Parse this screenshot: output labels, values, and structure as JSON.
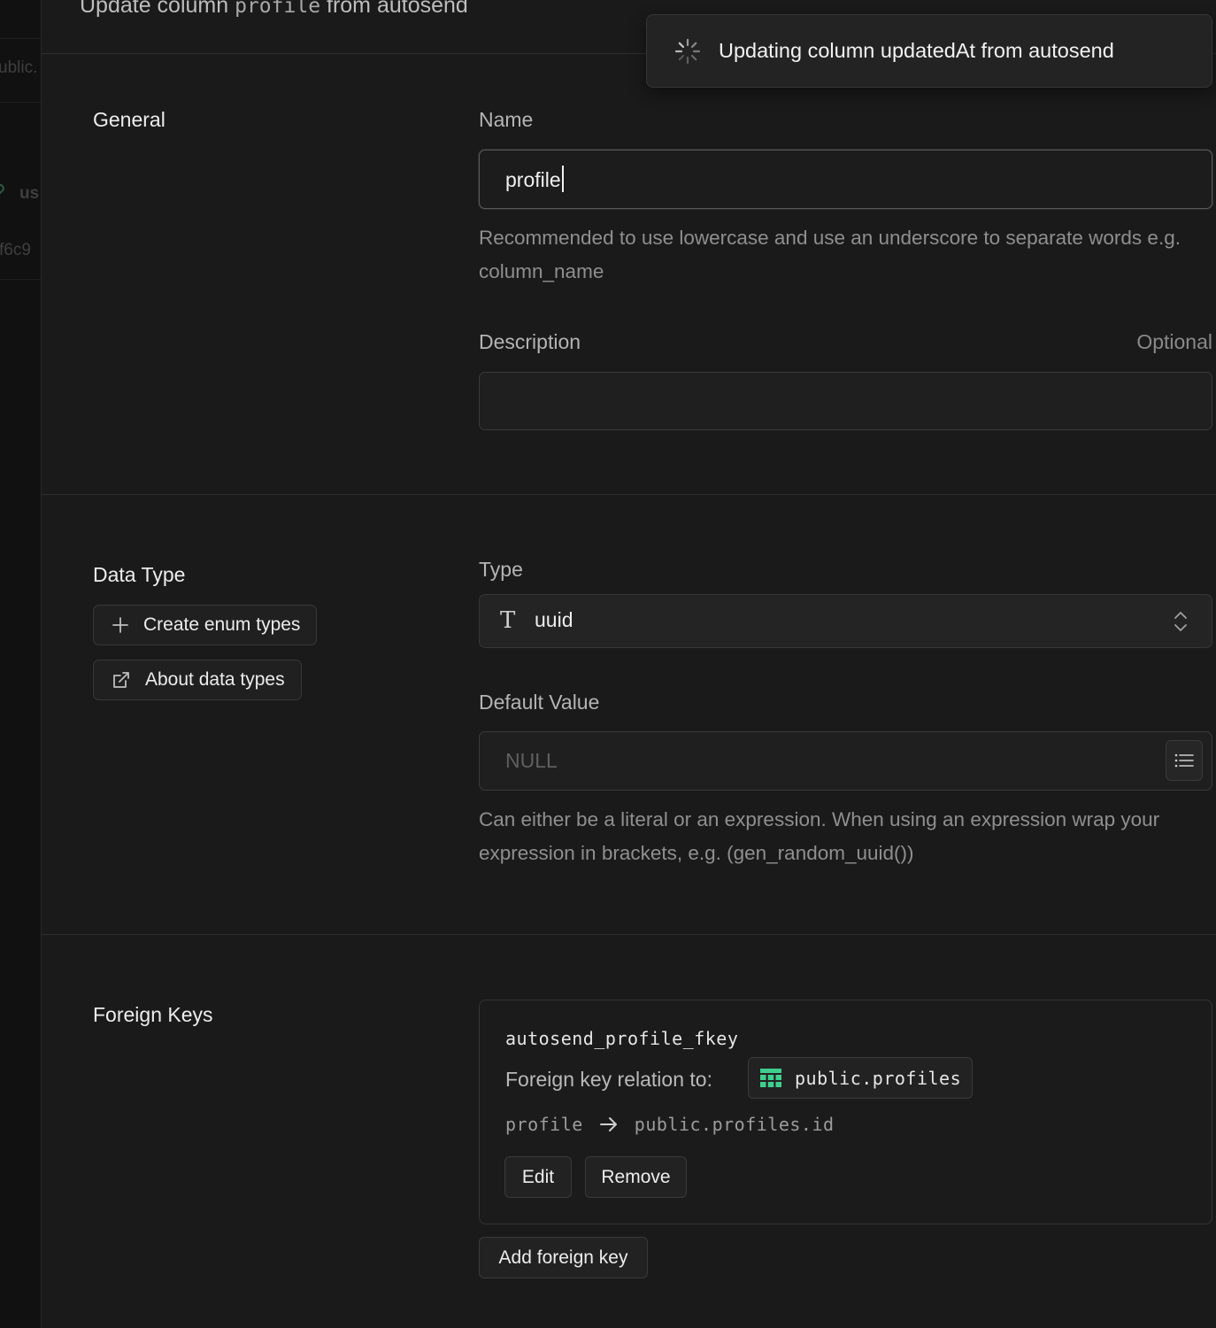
{
  "background_fragments": {
    "frag1": "ublic.",
    "frag2": "us",
    "frag3": "f6c9"
  },
  "header": {
    "title_prefix": "Update column",
    "column_name": "profile",
    "title_suffix": "from autosend"
  },
  "toast": {
    "icon": "spinner-icon",
    "message": "Updating column updatedAt from autosend"
  },
  "general": {
    "heading": "General",
    "name_label": "Name",
    "name_value": "profile",
    "name_help": "Recommended to use lowercase and use an underscore to separate words e.g. column_name",
    "description_label": "Description",
    "description_optional": "Optional",
    "description_value": ""
  },
  "data_type": {
    "heading": "Data Type",
    "create_enum_label": "Create enum types",
    "about_types_label": "About data types",
    "type_label": "Type",
    "type_icon_glyph": "T",
    "type_value": "uuid",
    "default_label": "Default Value",
    "default_placeholder": "NULL",
    "default_help": "Can either be a literal or an expression. When using an expression wrap your expression in brackets, e.g. (gen_random_uuid())"
  },
  "foreign_keys": {
    "heading": "Foreign Keys",
    "items": [
      {
        "name": "autosend_profile_fkey",
        "relation_label": "Foreign key relation to:",
        "relation_table": "public.profiles",
        "source_column": "profile",
        "target_column": "public.profiles.id",
        "edit_label": "Edit",
        "remove_label": "Remove"
      }
    ],
    "add_label": "Add foreign key"
  },
  "colors": {
    "background": "#171717",
    "panel": "#1a1a1a",
    "table_icon": "#3ecf8e"
  }
}
